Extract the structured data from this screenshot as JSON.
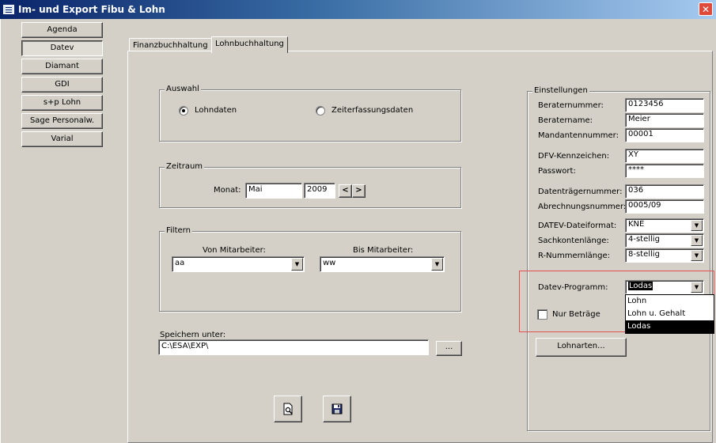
{
  "window": {
    "title": "Im- und Export Fibu & Lohn",
    "close_glyph": "✕"
  },
  "sidebar": {
    "items": [
      {
        "label": "Agenda"
      },
      {
        "label": "Datev"
      },
      {
        "label": "Diamant"
      },
      {
        "label": "GDI"
      },
      {
        "label": "s+p Lohn"
      },
      {
        "label": "Sage Personalw."
      },
      {
        "label": "Varial"
      }
    ],
    "active_index": 1
  },
  "tabs": [
    {
      "label": "Finanzbuchhaltung"
    },
    {
      "label": "Lohnbuchhaltung"
    }
  ],
  "auswahl": {
    "legend": "Auswahl",
    "option1": "Lohndaten",
    "option2": "Zeiterfassungsdaten",
    "selected": "Lohndaten"
  },
  "zeitraum": {
    "legend": "Zeitraum",
    "monat_label": "Monat:",
    "monat_value": "Mai",
    "year_value": "2009",
    "prev_glyph": "<",
    "next_glyph": ">"
  },
  "filtern": {
    "legend": "Filtern",
    "von_label": "Von Mitarbeiter:",
    "von_value": "aa",
    "bis_label": "Bis Mitarbeiter:",
    "bis_value": "ww"
  },
  "speichern": {
    "label": "Speichern unter:",
    "path": "C:\\ESA\\EXP\\",
    "browse_label": "..."
  },
  "einstellungen": {
    "legend": "Einstellungen",
    "beraternummer_label": "Beraternummer:",
    "beraternummer_value": "0123456",
    "beratername_label": "Beratername:",
    "beratername_value": "Meier",
    "mandantennummer_label": "Mandantennummer:",
    "mandantennummer_value": "00001",
    "dfv_label": "DFV-Kennzeichen:",
    "dfv_value": "XY",
    "passwort_label": "Passwort:",
    "passwort_value": "****",
    "datentraeger_label": "Datenträgernummer:",
    "datentraeger_value": "036",
    "abrechnung_label": "Abrechnungsnummer:",
    "abrechnung_value": "0005/09",
    "dateiformat_label": "DATEV-Dateiformat:",
    "dateiformat_value": "KNE",
    "sachkonten_label": "Sachkontenlänge:",
    "sachkonten_value": "4-stellig",
    "rnummern_label": "R-Nummernlänge:",
    "rnummern_value": "8-stellig",
    "programm_label": "Datev-Programm:",
    "programm_value": "Lodas",
    "programm_options": [
      "Lohn",
      "Lohn u. Gehalt",
      "Lodas"
    ],
    "nur_betraege_label": "Nur Beträge",
    "lohnarten_label": "Lohnarten..."
  },
  "icons": {
    "preview": "preview-icon",
    "save": "save-icon"
  },
  "colors": {
    "titlebar_start": "#0a246a",
    "highlight_box": "#e05050",
    "selected_item": "#000000"
  }
}
